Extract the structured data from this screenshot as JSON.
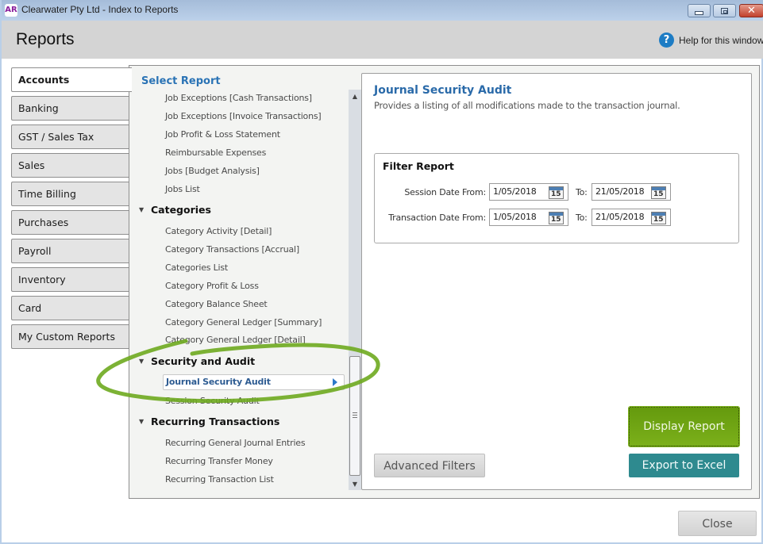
{
  "window": {
    "app_icon": "AR",
    "title": "Clearwater Pty Ltd - Index to Reports",
    "controls": [
      "minimize",
      "maximize",
      "close"
    ]
  },
  "header": {
    "title": "Reports",
    "help_label": "Help for this window",
    "help_icon": "question-mark-icon"
  },
  "categories": [
    {
      "label": "Accounts",
      "active": true
    },
    {
      "label": "Banking",
      "active": false
    },
    {
      "label": "GST / Sales Tax",
      "active": false
    },
    {
      "label": "Sales",
      "active": false
    },
    {
      "label": "Time Billing",
      "active": false
    },
    {
      "label": "Purchases",
      "active": false
    },
    {
      "label": "Payroll",
      "active": false
    },
    {
      "label": "Inventory",
      "active": false
    },
    {
      "label": "Card",
      "active": false
    },
    {
      "label": "My Custom Reports",
      "active": false
    }
  ],
  "report_list": {
    "heading": "Select Report",
    "jobs_items": [
      "Job Exceptions [Cash Transactions]",
      "Job Exceptions [Invoice Transactions]",
      "Job Profit & Loss Statement",
      "Reimbursable Expenses",
      "Jobs [Budget Analysis]",
      "Jobs List"
    ],
    "groups": [
      {
        "title": "Categories",
        "items": [
          "Category Activity [Detail]",
          "Category Transactions [Accrual]",
          "Categories List",
          "Category Profit & Loss",
          "Category Balance Sheet",
          "Category General Ledger [Summary]",
          "Category General Ledger [Detail]"
        ]
      },
      {
        "title": "Security and Audit",
        "items": [
          "Journal Security Audit",
          "Session Security Audit"
        ],
        "selected": "Journal Security Audit"
      },
      {
        "title": "Recurring Transactions",
        "items": [
          "Recurring General Journal Entries",
          "Recurring Transfer Money",
          "Recurring Transaction List"
        ]
      }
    ]
  },
  "detail": {
    "title": "Journal Security Audit",
    "description": "Provides a listing of all modifications made to the transaction journal.",
    "filter": {
      "heading": "Filter Report",
      "rows": [
        {
          "label": "Session Date From:",
          "from": "1/05/2018",
          "to_label": "To:",
          "to": "21/05/2018"
        },
        {
          "label": "Transaction Date From:",
          "from": "1/05/2018",
          "to_label": "To:",
          "to": "21/05/2018"
        }
      ],
      "calendar_icon_text": "15"
    },
    "buttons": {
      "advanced": "Advanced Filters",
      "display": "Display Report",
      "export": "Export to Excel"
    }
  },
  "footer": {
    "close": "Close"
  },
  "colors": {
    "accent_blue": "#2a73b5",
    "display_green": "#6fa512",
    "export_teal": "#2e8a8f",
    "annotation_green": "#6eaa1f"
  }
}
